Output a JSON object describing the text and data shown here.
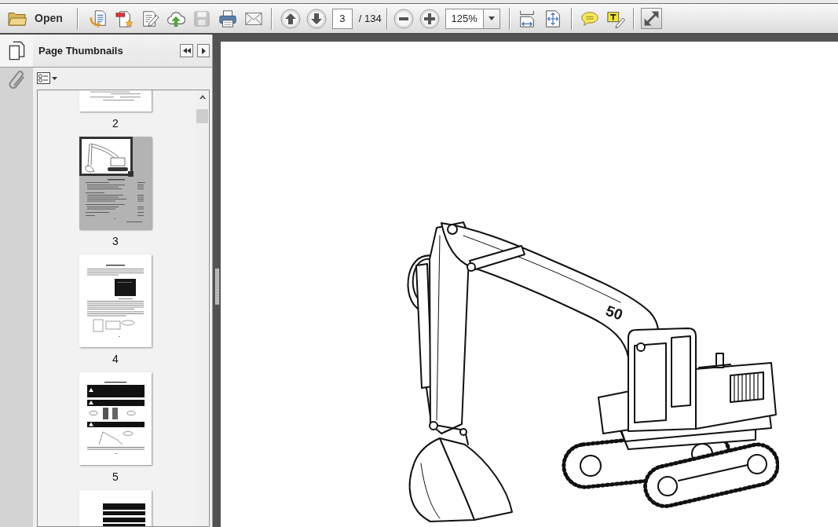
{
  "toolbar": {
    "open_label": "Open",
    "tools": [
      {
        "kind": "create",
        "disabled": false
      },
      {
        "kind": "export",
        "disabled": false
      },
      {
        "kind": "edit",
        "disabled": false
      },
      {
        "kind": "upload",
        "disabled": false
      },
      {
        "kind": "save",
        "disabled": true
      },
      {
        "kind": "print",
        "disabled": false
      },
      {
        "kind": "email",
        "disabled": false
      }
    ],
    "page_number": {
      "value": "3"
    },
    "page_count": "/ 134",
    "zoom": {
      "value": "125%"
    }
  },
  "sidebar": {
    "rail": [
      {
        "kind": "pages",
        "selected": true
      },
      {
        "kind": "attachments",
        "selected": false
      }
    ],
    "title": "Page Thumbnails",
    "thumbnails": [
      {
        "kind": "text",
        "label": "2",
        "selected": false
      },
      {
        "kind": "cover",
        "label": "3",
        "selected": true
      },
      {
        "kind": "photo",
        "label": "4",
        "selected": false
      },
      {
        "kind": "warnings",
        "label": "5",
        "selected": false
      },
      {
        "kind": "notices",
        "selected": false
      }
    ]
  },
  "document": {
    "figure_text": "50"
  }
}
